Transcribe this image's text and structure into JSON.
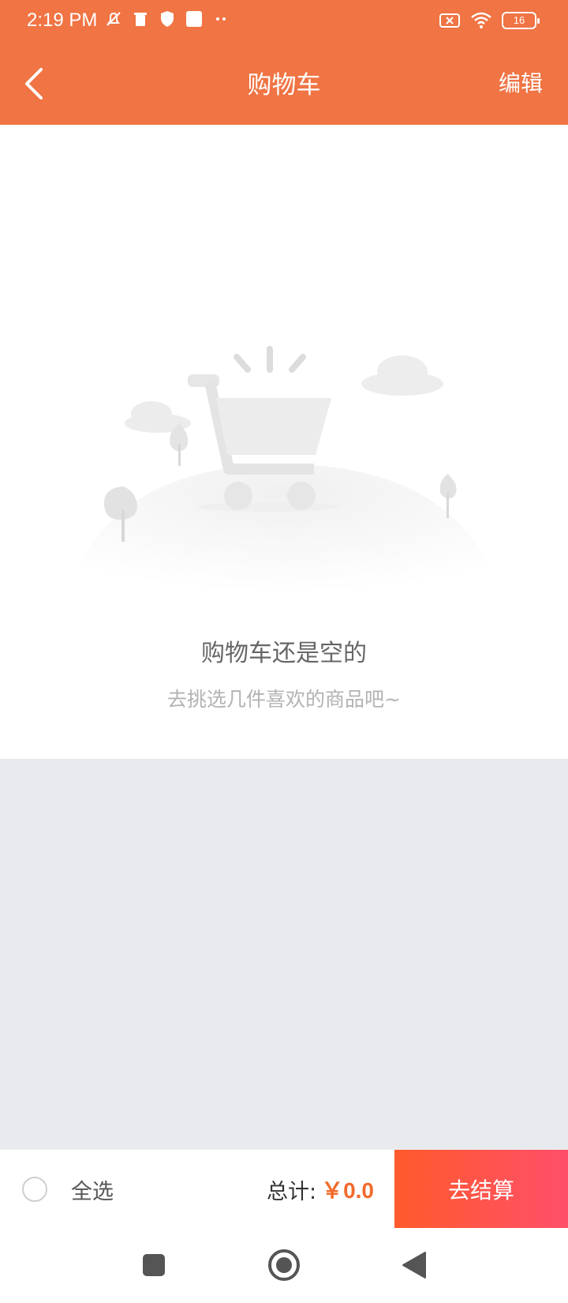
{
  "status_bar": {
    "time": "2:19 PM",
    "battery": "16"
  },
  "header": {
    "title": "购物车",
    "edit_label": "编辑"
  },
  "empty_state": {
    "title": "购物车还是空的",
    "subtitle": "去挑选几件喜欢的商品吧~"
  },
  "bottom_bar": {
    "select_all_label": "全选",
    "total_label": "总计:",
    "total_value": "￥0.0",
    "checkout_label": "去结算"
  },
  "colors": {
    "accent": "#f07444",
    "price": "#f26a2b",
    "checkout_start": "#ff5a2c",
    "checkout_end": "#ff4f6a",
    "background": "#e8eaee"
  },
  "icons": {
    "back": "chevron-left-icon",
    "cart_illustration": "empty-cart-illustration",
    "nav_recents": "square-icon",
    "nav_home": "circle-icon",
    "nav_back": "triangle-left-icon"
  }
}
